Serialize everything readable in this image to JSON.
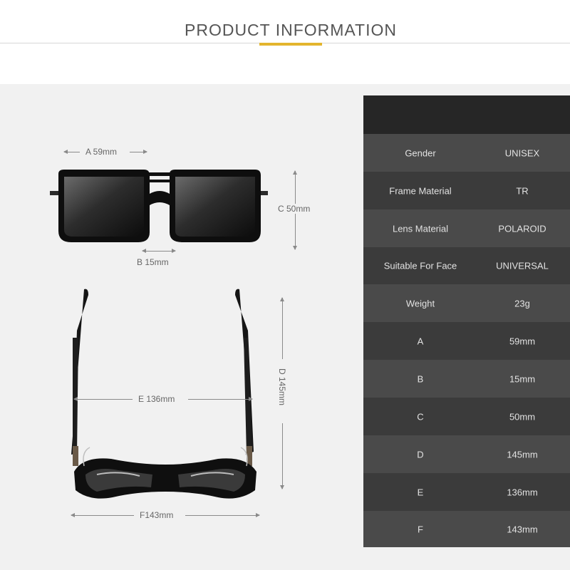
{
  "header": {
    "title": "PRODUCT INFORMATION",
    "accent_color": "#e3b52d"
  },
  "dimensions": {
    "a": "A 59mm",
    "b": "B 15mm",
    "c": "C 50mm",
    "d": "D 145mm",
    "e": "E 136mm",
    "f": "F143mm"
  },
  "specs": [
    {
      "label": "Gender",
      "value": "UNISEX"
    },
    {
      "label": "Frame Material",
      "value": "TR"
    },
    {
      "label": "Lens Material",
      "value": "POLAROID"
    },
    {
      "label": "Suitable For Face",
      "value": "UNIVERSAL"
    },
    {
      "label": "Weight",
      "value": "23g"
    },
    {
      "label": "A",
      "value": "59mm"
    },
    {
      "label": "B",
      "value": "15mm"
    },
    {
      "label": "C",
      "value": "50mm"
    },
    {
      "label": "D",
      "value": "145mm"
    },
    {
      "label": "E",
      "value": "136mm"
    },
    {
      "label": "F",
      "value": "143mm"
    }
  ],
  "colors": {
    "table_dark": "#262626",
    "row_light": "#4a4a4a",
    "row_dark": "#3b3b3b",
    "panel_bg": "#f1f1f1"
  }
}
